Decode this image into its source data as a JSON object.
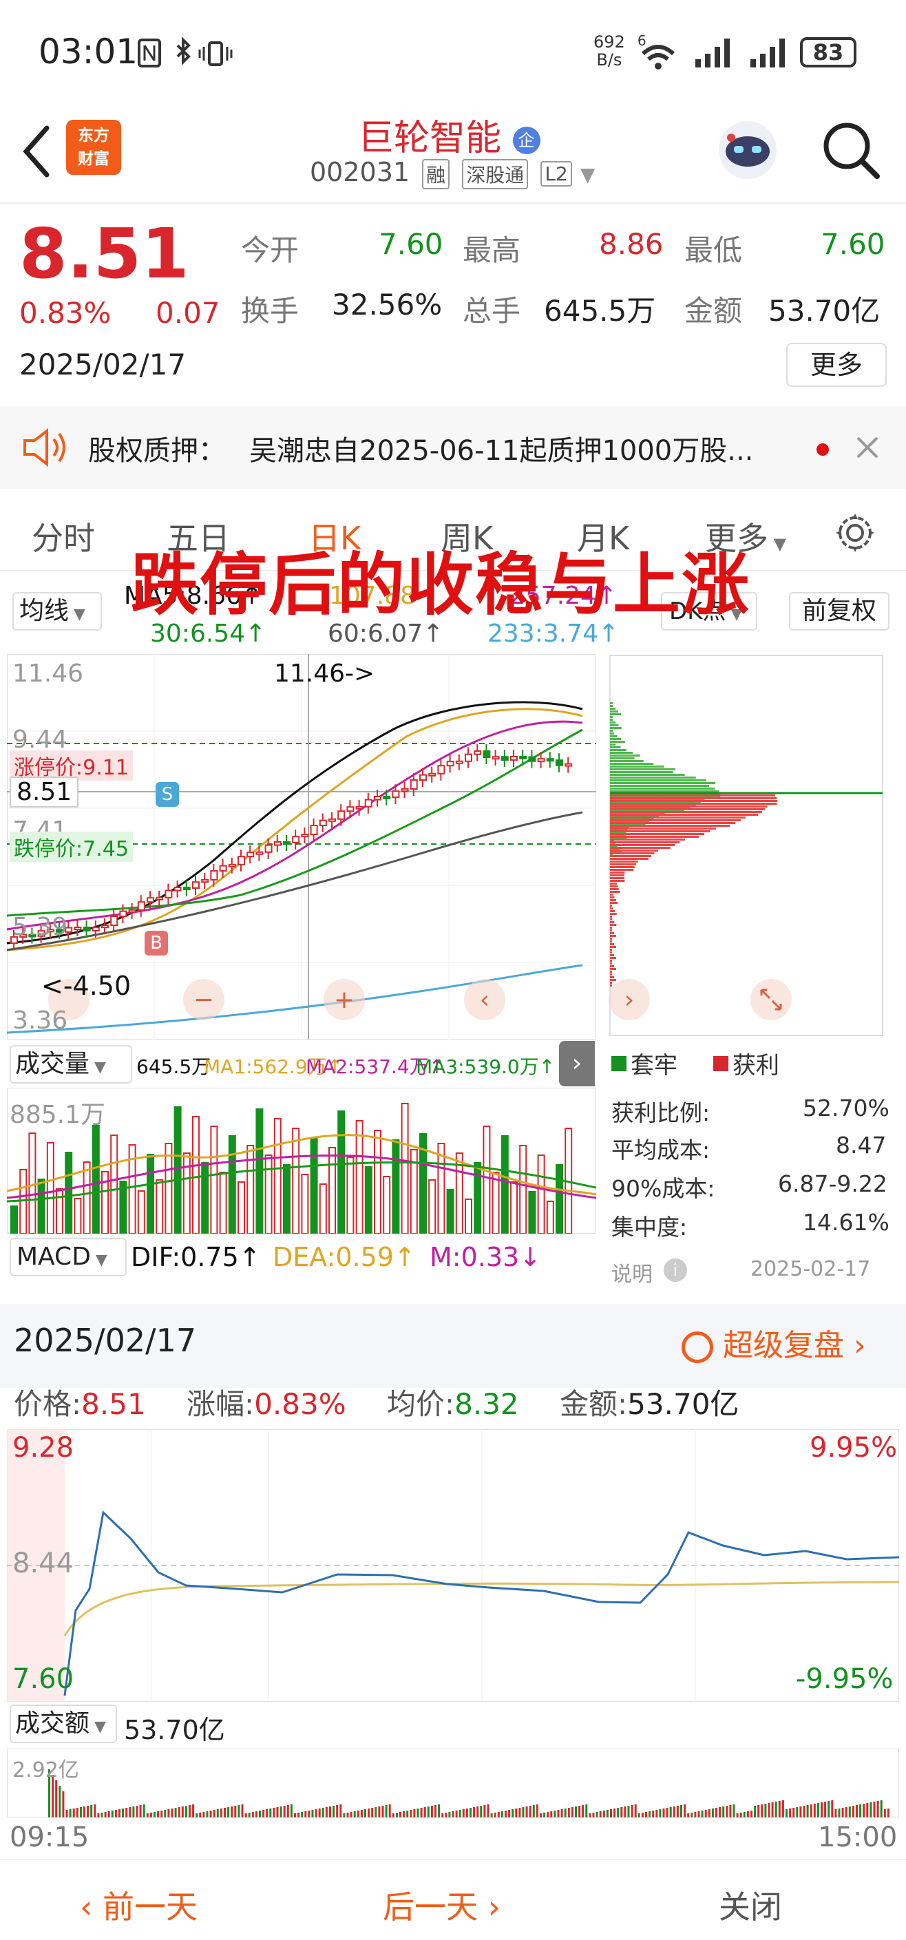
{
  "status_bar": {
    "time": "03:01",
    "net_speed_top": "692",
    "net_speed_unit": "B/s",
    "wifi_badge": "6",
    "battery": "83"
  },
  "header": {
    "logo_line1": "东方",
    "logo_line2": "财富",
    "stock_name": "巨轮智能",
    "stock_code": "002031",
    "tags": [
      "融",
      "深股通",
      "L2"
    ]
  },
  "quote": {
    "price": "8.51",
    "change_pct": "0.83%",
    "change": "0.07",
    "date": "2025/02/17",
    "open_label": "今开",
    "open": "7.60",
    "high_label": "最高",
    "high": "8.86",
    "low_label": "最低",
    "low": "7.60",
    "turnover_label": "换手",
    "turnover": "32.56%",
    "volume_label": "总手",
    "volume": "645.5万",
    "amount_label": "金额",
    "amount": "53.70亿",
    "more_button": "更多"
  },
  "notice": {
    "label": "股权质押：",
    "text": "吴潮忠自2025-06-11起质押1000万股..."
  },
  "tabs": [
    "分时",
    "五日",
    "日K",
    "周K",
    "月K",
    "更多"
  ],
  "active_tab": "日K",
  "overlay_title": "跌停后的收稳与上涨",
  "kline": {
    "ma_selector": "均线",
    "ma_label_a": "MA5:8.66↑",
    "ma_label_b": "107.88",
    "ma_label_c": "257.24↑",
    "ma30": "30:6.54↑",
    "ma60": "60:6.07↑",
    "ma233": "233:3.74↑",
    "dk_selector": "DK点",
    "adjust_button": "前复权",
    "y_top": "11.46",
    "y_944": "9.44",
    "limit_up": "涨停价:9.11",
    "current_tag": "8.51",
    "y_741": "7.41",
    "limit_down": "跌停价:7.45",
    "y_539": "5.39",
    "y_low": "3.36",
    "high_annotation": "11.46->",
    "low_annotation": "<-4.50",
    "s_marker": "S",
    "b_marker": "B",
    "colors": {
      "up": "#d9262c",
      "down": "#13921f",
      "ma5": "#111111",
      "ma10": "#e0a520",
      "ma20": "#c020a0",
      "ma30": "#1a9a1a",
      "ma60": "#555555",
      "ma233": "#4aa8d8"
    }
  },
  "volume_panel": {
    "selector": "成交量",
    "value": "645.5万",
    "ma1": "MA1:562.9万↑",
    "ma2": "MA2:537.4万↑",
    "ma3": "MA3:539.0万↑",
    "y_top": "885.1万"
  },
  "macd_panel": {
    "selector": "MACD",
    "dif": "DIF:0.75↑",
    "dea": "DEA:0.59↑",
    "m": "M:0.33↓"
  },
  "chip_panel": {
    "legend_trapped": "套牢",
    "legend_profit": "获利",
    "profit_ratio_label": "获利比例:",
    "profit_ratio": "52.70%",
    "avg_cost_label": "平均成本:",
    "avg_cost": "8.47",
    "cost90_label": "90%成本:",
    "cost90": "6.87-9.22",
    "concentration_label": "集中度:",
    "concentration": "14.61%",
    "note_label": "说明",
    "note_date": "2025-02-17"
  },
  "intraday": {
    "date": "2025/02/17",
    "replay_label": "超级复盘",
    "price_label": "价格:",
    "price": "8.51",
    "change_label": "涨幅:",
    "change": "0.83%",
    "avg_label": "均价:",
    "avg": "8.32",
    "amount_label": "金额:",
    "amount": "53.70亿",
    "y_top": "9.28",
    "y_mid": "8.44",
    "y_bottom": "7.60",
    "pct_top": "9.95%",
    "pct_bottom": "-9.95%",
    "volume_selector": "成交额",
    "volume_value": "53.70亿",
    "vol_y_top": "2.92亿",
    "time_start": "09:15",
    "time_end": "15:00"
  },
  "bottom_nav": {
    "prev": "前一天",
    "next": "后一天",
    "close": "关闭"
  }
}
